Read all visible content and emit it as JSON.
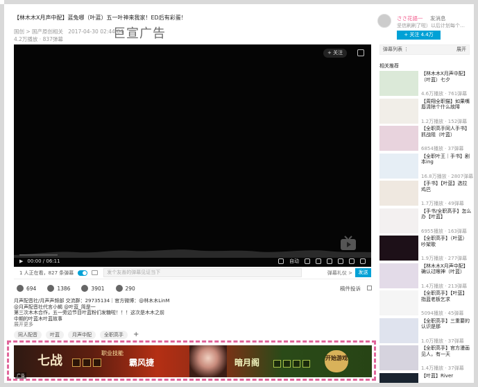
{
  "video": {
    "title": "【林木木X月声中配】蓝兔哪（叶蓝）五一叶神来我家！ED后有彩蛋！",
    "category": "国创 > 国产原创相关",
    "date": "2017-04-30 02:44:04",
    "stats_line": "4.2万播放 · 837弹幕"
  },
  "watermark": "巨宣广告",
  "player": {
    "follow_label": "+ 关注",
    "time": "00:00 / 06:11",
    "ctrl_auto": "自动"
  },
  "danmaku_bar": {
    "viewers": "1 人正在看，827 条弹幕",
    "placeholder": "发个友善的弹幕见证当下",
    "etiquette": "弹幕礼仪 >",
    "send": "发送"
  },
  "actions": {
    "like": "694",
    "coin": "1386",
    "fav": "3901",
    "share": "290",
    "report": "稿件投诉"
  },
  "description": {
    "line1": "月声配音社/月声声频部 交流群：29735134｜官方微博：@林木木LinM",
    "line2": "@月声配音社代言小蝎 @叶蓝_简是一",
    "line3": "第三次木木合作，五一旁边节目叶蓝粉们发糖啦！！！这次是木木之前",
    "line4": "中期的叶蓝木叶蓝故事",
    "expand": "展开更多"
  },
  "tags": [
    "同人配音",
    "叶蓝",
    "月声中配",
    "全职高手"
  ],
  "tag_add": "+",
  "ad": {
    "logo": "七战",
    "skill": "职业技能",
    "brand1": "霸风捷",
    "brand2": "暗月阁",
    "start": "开始游戏",
    "label": "广告"
  },
  "up": {
    "name": "ささ花語一",
    "msg": "发消息",
    "sign": "坚信刷刷了啦）以后计划每个…",
    "follow": "+ 关注 4.4万"
  },
  "sidebar": {
    "danmaku_list": "弹幕列表 ⋮",
    "expand": "展开",
    "related_title": "相关推荐",
    "items": [
      {
        "title": "【林木木X月声中配】（叶蓝）七夕",
        "stat": "4.6万播放 · 761弹幕"
      },
      {
        "title": "【周翔全职猫】如果嘴唇清除个什么故障",
        "stat": "1.2万播放 · 152弹幕"
      },
      {
        "title": "【全职高手同人手书】抓战阻（叶蓝）",
        "stat": "6854播放 · 37弹幕"
      },
      {
        "title": "【全职叶王｜手书】剧本ing",
        "stat": "16.8万播放 · 2807弹幕"
      },
      {
        "title": "【手书】【叶蓝】选拉鸡巴",
        "stat": "1.7万播放 · 49弹幕"
      },
      {
        "title": "【手书/全职高手】怎么办【叶蓝】",
        "stat": "6955播放 · 163弹幕"
      },
      {
        "title": "【全职高手】（叶蓝）吵架歌",
        "stat": "1.9万播放 · 277弹幕"
      },
      {
        "title": "【林木木X月声中配】确认过眼神（叶蓝）",
        "stat": "1.4万播放 · 213弹幕"
      },
      {
        "title": "【全职高手】【叶蓝】指蓝老板乞求",
        "stat": "5094播放 · 45弹幕"
      },
      {
        "title": "【全职高手】三重要的认识是那",
        "stat": "1.0万播放 · 37弹幕"
      },
      {
        "title": "【全职高手】官方漫画见人，有一天",
        "stat": "1.4万播放 · 37弹幕"
      },
      {
        "title": "【叶蓝】River",
        "stat": ""
      }
    ]
  },
  "colors": {
    "accent": "#00a1d6",
    "up_name": "#f25d8e",
    "ad_frame": "#e0669b"
  }
}
